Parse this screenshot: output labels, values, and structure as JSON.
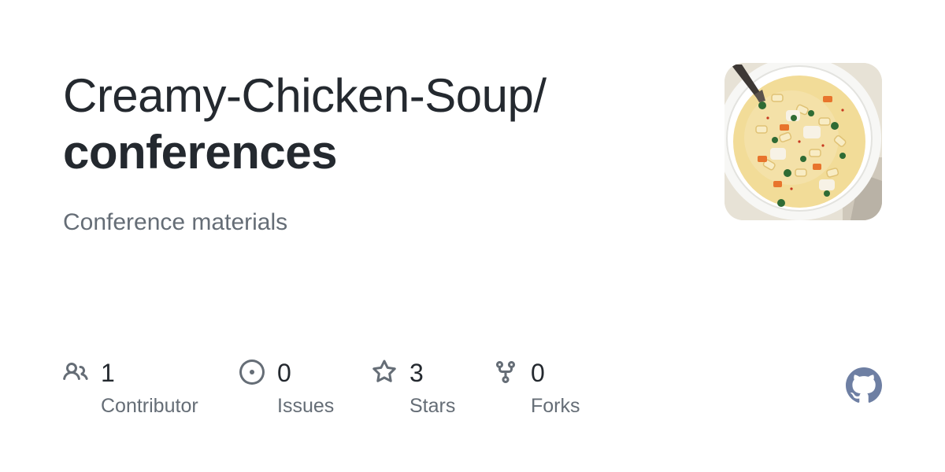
{
  "repo": {
    "owner": "Creamy-Chicken-Soup/",
    "name": "conferences",
    "description": "Conference materials"
  },
  "avatar": {
    "icon": "soup-bowl-image"
  },
  "stats": {
    "contributors": {
      "count": "1",
      "label": "Contributor",
      "icon": "people-icon"
    },
    "issues": {
      "count": "0",
      "label": "Issues",
      "icon": "issue-opened-icon"
    },
    "stars": {
      "count": "3",
      "label": "Stars",
      "icon": "star-icon"
    },
    "forks": {
      "count": "0",
      "label": "Forks",
      "icon": "repo-forked-icon"
    }
  },
  "brand": {
    "logo": "github-mark-icon",
    "icon_color": "#656d76",
    "logo_color": "#6e7fa3"
  }
}
